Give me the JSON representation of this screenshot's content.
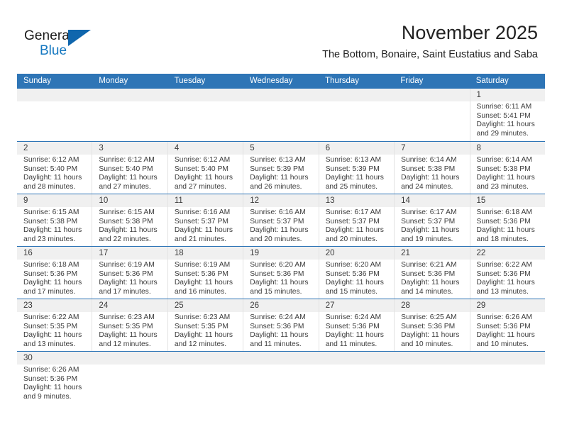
{
  "logo": {
    "word_top": "General",
    "word_bottom": "Blue",
    "accent_color": "#1477c0",
    "flag_color": "#1066ad"
  },
  "header": {
    "title": "November 2025",
    "subtitle": "The Bottom, Bonaire, Saint Eustatius and Saba"
  },
  "theme": {
    "header_row_bg": "#2e75b6",
    "date_band_bg": "#f0f0f0",
    "row_separator": "#2e75b6",
    "text": "#3b3b3b"
  },
  "weekdays": [
    "Sunday",
    "Monday",
    "Tuesday",
    "Wednesday",
    "Thursday",
    "Friday",
    "Saturday"
  ],
  "weeks": [
    [
      {
        "day": "",
        "sunrise": "",
        "sunset": "",
        "daylight_line1": "",
        "daylight_line2": ""
      },
      {
        "day": "",
        "sunrise": "",
        "sunset": "",
        "daylight_line1": "",
        "daylight_line2": ""
      },
      {
        "day": "",
        "sunrise": "",
        "sunset": "",
        "daylight_line1": "",
        "daylight_line2": ""
      },
      {
        "day": "",
        "sunrise": "",
        "sunset": "",
        "daylight_line1": "",
        "daylight_line2": ""
      },
      {
        "day": "",
        "sunrise": "",
        "sunset": "",
        "daylight_line1": "",
        "daylight_line2": ""
      },
      {
        "day": "",
        "sunrise": "",
        "sunset": "",
        "daylight_line1": "",
        "daylight_line2": ""
      },
      {
        "day": "1",
        "sunrise": "Sunrise: 6:11 AM",
        "sunset": "Sunset: 5:41 PM",
        "daylight_line1": "Daylight: 11 hours",
        "daylight_line2": "and 29 minutes."
      }
    ],
    [
      {
        "day": "2",
        "sunrise": "Sunrise: 6:12 AM",
        "sunset": "Sunset: 5:40 PM",
        "daylight_line1": "Daylight: 11 hours",
        "daylight_line2": "and 28 minutes."
      },
      {
        "day": "3",
        "sunrise": "Sunrise: 6:12 AM",
        "sunset": "Sunset: 5:40 PM",
        "daylight_line1": "Daylight: 11 hours",
        "daylight_line2": "and 27 minutes."
      },
      {
        "day": "4",
        "sunrise": "Sunrise: 6:12 AM",
        "sunset": "Sunset: 5:40 PM",
        "daylight_line1": "Daylight: 11 hours",
        "daylight_line2": "and 27 minutes."
      },
      {
        "day": "5",
        "sunrise": "Sunrise: 6:13 AM",
        "sunset": "Sunset: 5:39 PM",
        "daylight_line1": "Daylight: 11 hours",
        "daylight_line2": "and 26 minutes."
      },
      {
        "day": "6",
        "sunrise": "Sunrise: 6:13 AM",
        "sunset": "Sunset: 5:39 PM",
        "daylight_line1": "Daylight: 11 hours",
        "daylight_line2": "and 25 minutes."
      },
      {
        "day": "7",
        "sunrise": "Sunrise: 6:14 AM",
        "sunset": "Sunset: 5:38 PM",
        "daylight_line1": "Daylight: 11 hours",
        "daylight_line2": "and 24 minutes."
      },
      {
        "day": "8",
        "sunrise": "Sunrise: 6:14 AM",
        "sunset": "Sunset: 5:38 PM",
        "daylight_line1": "Daylight: 11 hours",
        "daylight_line2": "and 23 minutes."
      }
    ],
    [
      {
        "day": "9",
        "sunrise": "Sunrise: 6:15 AM",
        "sunset": "Sunset: 5:38 PM",
        "daylight_line1": "Daylight: 11 hours",
        "daylight_line2": "and 23 minutes."
      },
      {
        "day": "10",
        "sunrise": "Sunrise: 6:15 AM",
        "sunset": "Sunset: 5:38 PM",
        "daylight_line1": "Daylight: 11 hours",
        "daylight_line2": "and 22 minutes."
      },
      {
        "day": "11",
        "sunrise": "Sunrise: 6:16 AM",
        "sunset": "Sunset: 5:37 PM",
        "daylight_line1": "Daylight: 11 hours",
        "daylight_line2": "and 21 minutes."
      },
      {
        "day": "12",
        "sunrise": "Sunrise: 6:16 AM",
        "sunset": "Sunset: 5:37 PM",
        "daylight_line1": "Daylight: 11 hours",
        "daylight_line2": "and 20 minutes."
      },
      {
        "day": "13",
        "sunrise": "Sunrise: 6:17 AM",
        "sunset": "Sunset: 5:37 PM",
        "daylight_line1": "Daylight: 11 hours",
        "daylight_line2": "and 20 minutes."
      },
      {
        "day": "14",
        "sunrise": "Sunrise: 6:17 AM",
        "sunset": "Sunset: 5:37 PM",
        "daylight_line1": "Daylight: 11 hours",
        "daylight_line2": "and 19 minutes."
      },
      {
        "day": "15",
        "sunrise": "Sunrise: 6:18 AM",
        "sunset": "Sunset: 5:36 PM",
        "daylight_line1": "Daylight: 11 hours",
        "daylight_line2": "and 18 minutes."
      }
    ],
    [
      {
        "day": "16",
        "sunrise": "Sunrise: 6:18 AM",
        "sunset": "Sunset: 5:36 PM",
        "daylight_line1": "Daylight: 11 hours",
        "daylight_line2": "and 17 minutes."
      },
      {
        "day": "17",
        "sunrise": "Sunrise: 6:19 AM",
        "sunset": "Sunset: 5:36 PM",
        "daylight_line1": "Daylight: 11 hours",
        "daylight_line2": "and 17 minutes."
      },
      {
        "day": "18",
        "sunrise": "Sunrise: 6:19 AM",
        "sunset": "Sunset: 5:36 PM",
        "daylight_line1": "Daylight: 11 hours",
        "daylight_line2": "and 16 minutes."
      },
      {
        "day": "19",
        "sunrise": "Sunrise: 6:20 AM",
        "sunset": "Sunset: 5:36 PM",
        "daylight_line1": "Daylight: 11 hours",
        "daylight_line2": "and 15 minutes."
      },
      {
        "day": "20",
        "sunrise": "Sunrise: 6:20 AM",
        "sunset": "Sunset: 5:36 PM",
        "daylight_line1": "Daylight: 11 hours",
        "daylight_line2": "and 15 minutes."
      },
      {
        "day": "21",
        "sunrise": "Sunrise: 6:21 AM",
        "sunset": "Sunset: 5:36 PM",
        "daylight_line1": "Daylight: 11 hours",
        "daylight_line2": "and 14 minutes."
      },
      {
        "day": "22",
        "sunrise": "Sunrise: 6:22 AM",
        "sunset": "Sunset: 5:36 PM",
        "daylight_line1": "Daylight: 11 hours",
        "daylight_line2": "and 13 minutes."
      }
    ],
    [
      {
        "day": "23",
        "sunrise": "Sunrise: 6:22 AM",
        "sunset": "Sunset: 5:35 PM",
        "daylight_line1": "Daylight: 11 hours",
        "daylight_line2": "and 13 minutes."
      },
      {
        "day": "24",
        "sunrise": "Sunrise: 6:23 AM",
        "sunset": "Sunset: 5:35 PM",
        "daylight_line1": "Daylight: 11 hours",
        "daylight_line2": "and 12 minutes."
      },
      {
        "day": "25",
        "sunrise": "Sunrise: 6:23 AM",
        "sunset": "Sunset: 5:35 PM",
        "daylight_line1": "Daylight: 11 hours",
        "daylight_line2": "and 12 minutes."
      },
      {
        "day": "26",
        "sunrise": "Sunrise: 6:24 AM",
        "sunset": "Sunset: 5:36 PM",
        "daylight_line1": "Daylight: 11 hours",
        "daylight_line2": "and 11 minutes."
      },
      {
        "day": "27",
        "sunrise": "Sunrise: 6:24 AM",
        "sunset": "Sunset: 5:36 PM",
        "daylight_line1": "Daylight: 11 hours",
        "daylight_line2": "and 11 minutes."
      },
      {
        "day": "28",
        "sunrise": "Sunrise: 6:25 AM",
        "sunset": "Sunset: 5:36 PM",
        "daylight_line1": "Daylight: 11 hours",
        "daylight_line2": "and 10 minutes."
      },
      {
        "day": "29",
        "sunrise": "Sunrise: 6:26 AM",
        "sunset": "Sunset: 5:36 PM",
        "daylight_line1": "Daylight: 11 hours",
        "daylight_line2": "and 10 minutes."
      }
    ],
    [
      {
        "day": "30",
        "sunrise": "Sunrise: 6:26 AM",
        "sunset": "Sunset: 5:36 PM",
        "daylight_line1": "Daylight: 11 hours",
        "daylight_line2": "and 9 minutes."
      },
      {
        "day": "",
        "sunrise": "",
        "sunset": "",
        "daylight_line1": "",
        "daylight_line2": ""
      },
      {
        "day": "",
        "sunrise": "",
        "sunset": "",
        "daylight_line1": "",
        "daylight_line2": ""
      },
      {
        "day": "",
        "sunrise": "",
        "sunset": "",
        "daylight_line1": "",
        "daylight_line2": ""
      },
      {
        "day": "",
        "sunrise": "",
        "sunset": "",
        "daylight_line1": "",
        "daylight_line2": ""
      },
      {
        "day": "",
        "sunrise": "",
        "sunset": "",
        "daylight_line1": "",
        "daylight_line2": ""
      },
      {
        "day": "",
        "sunrise": "",
        "sunset": "",
        "daylight_line1": "",
        "daylight_line2": ""
      }
    ]
  ]
}
